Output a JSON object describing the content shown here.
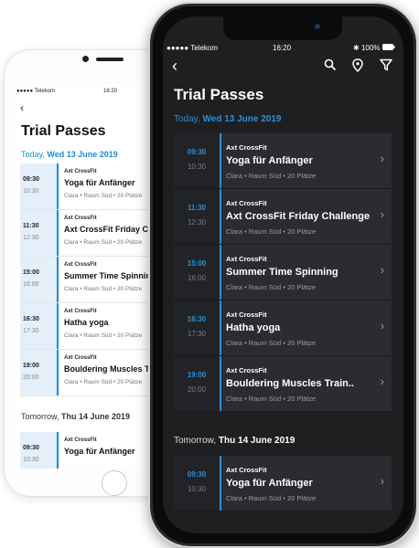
{
  "back_phone": {
    "status": {
      "carrier": "●●●●● Telekom",
      "time": "16:20"
    },
    "title": "Trial Passes",
    "section1": {
      "prefix": "Today, ",
      "date": "Wed 13 June 2019"
    },
    "sessions": [
      {
        "start": "09:30",
        "end": "10:30",
        "org": "Axt CrossFit",
        "name": "Yoga für Anfänger",
        "meta": "Clara • Raum Süd • 20 Plätze"
      },
      {
        "start": "11:30",
        "end": "12:30",
        "org": "Axt CrossFit",
        "name": "Axt CrossFit Friday C",
        "meta": "Clara • Raum Süd • 20 Plätze"
      },
      {
        "start": "15:00",
        "end": "16:00",
        "org": "Axt CrossFit",
        "name": "Summer Time Spinnin",
        "meta": "Clara • Raum Süd • 20 Plätze"
      },
      {
        "start": "16:30",
        "end": "17:30",
        "org": "Axt CrossFit",
        "name": "Hatha yoga",
        "meta": "Clara • Raum Süd • 20 Plätze"
      },
      {
        "start": "19:00",
        "end": "20:00",
        "org": "Axt CrossFit",
        "name": "Bouldering Muscles T",
        "meta": "Clara • Raum Süd • 20 Plätze"
      }
    ],
    "section2": {
      "prefix": "Tomorrow, ",
      "date": "Thu 14 June 2019"
    },
    "sessions2": [
      {
        "start": "09:30",
        "end": "10:30",
        "org": "Axt CrossFit",
        "name": "Yoga für Anfänger",
        "meta": ""
      }
    ]
  },
  "front_phone": {
    "status": {
      "carrier": "●●●●● Telekom",
      "time": "16:20",
      "battery": "100%"
    },
    "title": "Trial Passes",
    "section1": {
      "prefix": "Today, ",
      "date": "Wed 13 June 2019"
    },
    "sessions": [
      {
        "start": "09:30",
        "end": "10:30",
        "org": "Axt CrossFit",
        "name": "Yoga für Anfänger",
        "meta": "Clara • Raum Süd • 20 Plätze"
      },
      {
        "start": "11:30",
        "end": "12:30",
        "org": "Axt CrossFit",
        "name": "Axt CrossFit Friday Challenge",
        "meta": "Clara • Raum Süd • 20 Plätze"
      },
      {
        "start": "15:00",
        "end": "16:00",
        "org": "Axt CrossFit",
        "name": "Summer Time Spinning",
        "meta": "Clara • Raum Süd • 20 Plätze"
      },
      {
        "start": "16:30",
        "end": "17:30",
        "org": "Axt CrossFit",
        "name": "Hatha yoga",
        "meta": "Clara • Raum Süd • 20 Plätze"
      },
      {
        "start": "19:00",
        "end": "20:00",
        "org": "Axt CrossFit",
        "name": "Bouldering Muscles Train..",
        "meta": "Clara • Raum Süd • 20 Plätze"
      }
    ],
    "section2": {
      "prefix": "Tomorrow, ",
      "date": "Thu 14 June 2019"
    },
    "sessions2": [
      {
        "start": "09:30",
        "end": "10:30",
        "org": "Axt CrossFit",
        "name": "Yoga für Anfänger",
        "meta": "Clara • Raum Süd • 20 Plätze"
      }
    ]
  },
  "icons": [
    "back-icon",
    "search-icon",
    "location-pin-icon",
    "filter-icon",
    "chevron-right-icon",
    "wifi-icon",
    "bluetooth-icon",
    "battery-icon"
  ],
  "colors": {
    "accent": "#2b8fd9",
    "dark_bg": "#1e1f21",
    "dark_card": "#2a2c2f",
    "light_time_bg": "#e4eff9"
  }
}
